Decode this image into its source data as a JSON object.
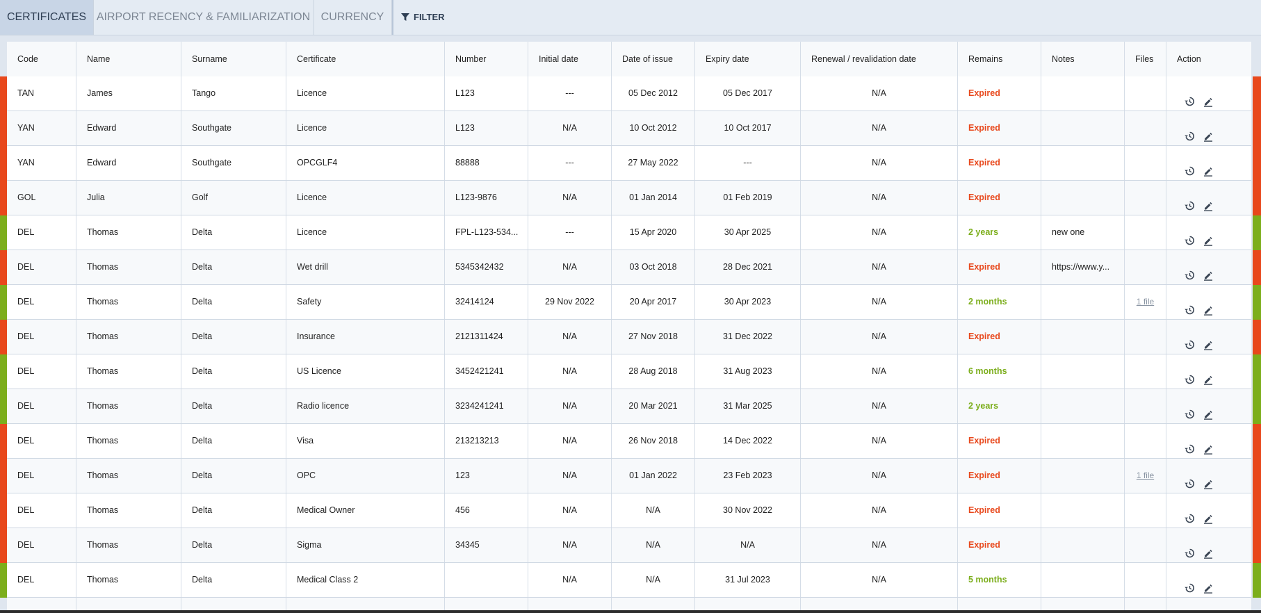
{
  "tabs": [
    {
      "label": "CERTIFICATES",
      "active": true
    },
    {
      "label": "AIRPORT RECENCY & FAMILIARIZATION",
      "active": false
    },
    {
      "label": "CURRENCY",
      "active": false
    }
  ],
  "filter_label": "FILTER",
  "columns": [
    "Code",
    "Name",
    "Surname",
    "Certificate",
    "Number",
    "Initial date",
    "Date of issue",
    "Expiry date",
    "Renewal / revalidation date",
    "Remains",
    "Notes",
    "Files",
    "Action"
  ],
  "colors": {
    "expired": "#e8481c",
    "valid": "#7cae1c"
  },
  "rows": [
    {
      "code": "TAN",
      "name": "James",
      "surname": "Tango",
      "certificate": "Licence",
      "number": "L123",
      "initial": "---",
      "issue": "05 Dec 2012",
      "expiry": "05 Dec 2017",
      "renewal": "N/A",
      "remains": "Expired",
      "status": "expired",
      "notes": "",
      "files": ""
    },
    {
      "code": "YAN",
      "name": "Edward",
      "surname": "Southgate",
      "certificate": "Licence",
      "number": "L123",
      "initial": "N/A",
      "issue": "10 Oct 2012",
      "expiry": "10 Oct 2017",
      "renewal": "N/A",
      "remains": "Expired",
      "status": "expired",
      "notes": "",
      "files": ""
    },
    {
      "code": "YAN",
      "name": "Edward",
      "surname": "Southgate",
      "certificate": "OPCGLF4",
      "number": "88888",
      "initial": "---",
      "issue": "27 May 2022",
      "expiry": "---",
      "renewal": "N/A",
      "remains": "Expired",
      "status": "expired",
      "notes": "",
      "files": ""
    },
    {
      "code": "GOL",
      "name": "Julia",
      "surname": "Golf",
      "certificate": "Licence",
      "number": "L123-9876",
      "initial": "N/A",
      "issue": "01 Jan 2014",
      "expiry": "01 Feb 2019",
      "renewal": "N/A",
      "remains": "Expired",
      "status": "expired",
      "notes": "",
      "files": ""
    },
    {
      "code": "DEL",
      "name": "Thomas",
      "surname": "Delta",
      "certificate": "Licence",
      "number": "FPL-L123-534...",
      "initial": "---",
      "issue": "15 Apr 2020",
      "expiry": "30 Apr 2025",
      "renewal": "N/A",
      "remains": "2 years",
      "status": "valid",
      "notes": "new one",
      "files": ""
    },
    {
      "code": "DEL",
      "name": "Thomas",
      "surname": "Delta",
      "certificate": "Wet drill",
      "number": "5345342432",
      "initial": "N/A",
      "issue": "03 Oct 2018",
      "expiry": "28 Dec 2021",
      "renewal": "N/A",
      "remains": "Expired",
      "status": "expired",
      "notes": "https://www.y...",
      "files": ""
    },
    {
      "code": "DEL",
      "name": "Thomas",
      "surname": "Delta",
      "certificate": "Safety",
      "number": "32414124",
      "initial": "29 Nov 2022",
      "issue": "20 Apr 2017",
      "expiry": "30 Apr 2023",
      "renewal": "N/A",
      "remains": "2 months",
      "status": "valid",
      "notes": "",
      "files": "1 file"
    },
    {
      "code": "DEL",
      "name": "Thomas",
      "surname": "Delta",
      "certificate": "Insurance",
      "number": "2121311424",
      "initial": "N/A",
      "issue": "27 Nov 2018",
      "expiry": "31 Dec 2022",
      "renewal": "N/A",
      "remains": "Expired",
      "status": "expired",
      "notes": "",
      "files": ""
    },
    {
      "code": "DEL",
      "name": "Thomas",
      "surname": "Delta",
      "certificate": "US Licence",
      "number": "3452421241",
      "initial": "N/A",
      "issue": "28 Aug 2018",
      "expiry": "31 Aug 2023",
      "renewal": "N/A",
      "remains": "6 months",
      "status": "valid",
      "notes": "",
      "files": ""
    },
    {
      "code": "DEL",
      "name": "Thomas",
      "surname": "Delta",
      "certificate": "Radio licence",
      "number": "3234241241",
      "initial": "N/A",
      "issue": "20 Mar 2021",
      "expiry": "31 Mar 2025",
      "renewal": "N/A",
      "remains": "2 years",
      "status": "valid",
      "notes": "",
      "files": ""
    },
    {
      "code": "DEL",
      "name": "Thomas",
      "surname": "Delta",
      "certificate": "Visa",
      "number": "213213213",
      "initial": "N/A",
      "issue": "26 Nov 2018",
      "expiry": "14 Dec 2022",
      "renewal": "N/A",
      "remains": "Expired",
      "status": "expired",
      "notes": "",
      "files": ""
    },
    {
      "code": "DEL",
      "name": "Thomas",
      "surname": "Delta",
      "certificate": "OPC",
      "number": "123",
      "initial": "N/A",
      "issue": "01 Jan 2022",
      "expiry": "23 Feb 2023",
      "renewal": "N/A",
      "remains": "Expired",
      "status": "expired",
      "notes": "",
      "files": "1 file"
    },
    {
      "code": "DEL",
      "name": "Thomas",
      "surname": "Delta",
      "certificate": "Medical Owner",
      "number": "456",
      "initial": "N/A",
      "issue": "N/A",
      "expiry": "30 Nov 2022",
      "renewal": "N/A",
      "remains": "Expired",
      "status": "expired",
      "notes": "",
      "files": ""
    },
    {
      "code": "DEL",
      "name": "Thomas",
      "surname": "Delta",
      "certificate": "Sigma",
      "number": "34345",
      "initial": "N/A",
      "issue": "N/A",
      "expiry": "N/A",
      "renewal": "N/A",
      "remains": "Expired",
      "status": "expired",
      "notes": "",
      "files": ""
    },
    {
      "code": "DEL",
      "name": "Thomas",
      "surname": "Delta",
      "certificate": "Medical Class 2",
      "number": "",
      "initial": "N/A",
      "issue": "N/A",
      "expiry": "31 Jul 2023",
      "renewal": "N/A",
      "remains": "5 months",
      "status": "valid",
      "notes": "",
      "files": ""
    }
  ]
}
